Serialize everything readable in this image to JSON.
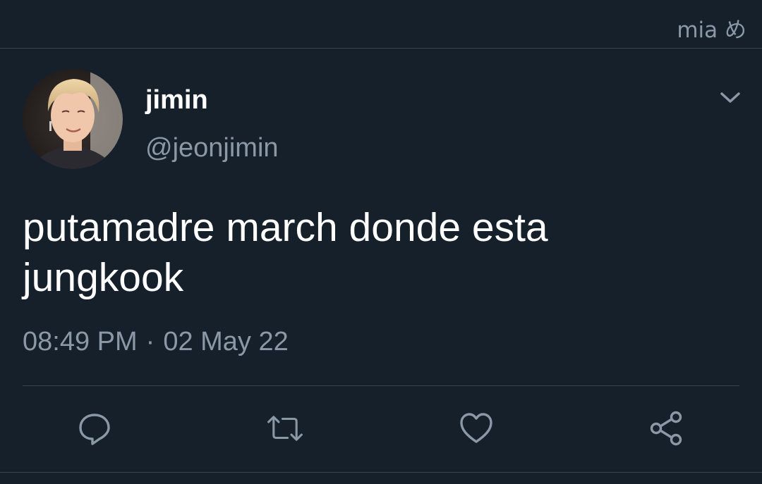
{
  "watermark": "mia め",
  "tweet": {
    "display_name": "jimin",
    "handle": "@jeonjimin",
    "text_line1": "putamadre march donde esta",
    "text_line2": "jungkook",
    "time": "08:49 PM",
    "separator": "·",
    "date": "02 May 22"
  },
  "icons": {
    "more": "chevron-down-icon",
    "reply": "reply-icon",
    "retweet": "retweet-icon",
    "like": "heart-icon",
    "share": "share-icon"
  },
  "colors": {
    "background": "#15202b",
    "text_primary": "#ffffff",
    "text_secondary": "#8b98a5",
    "divider": "#38444d"
  }
}
